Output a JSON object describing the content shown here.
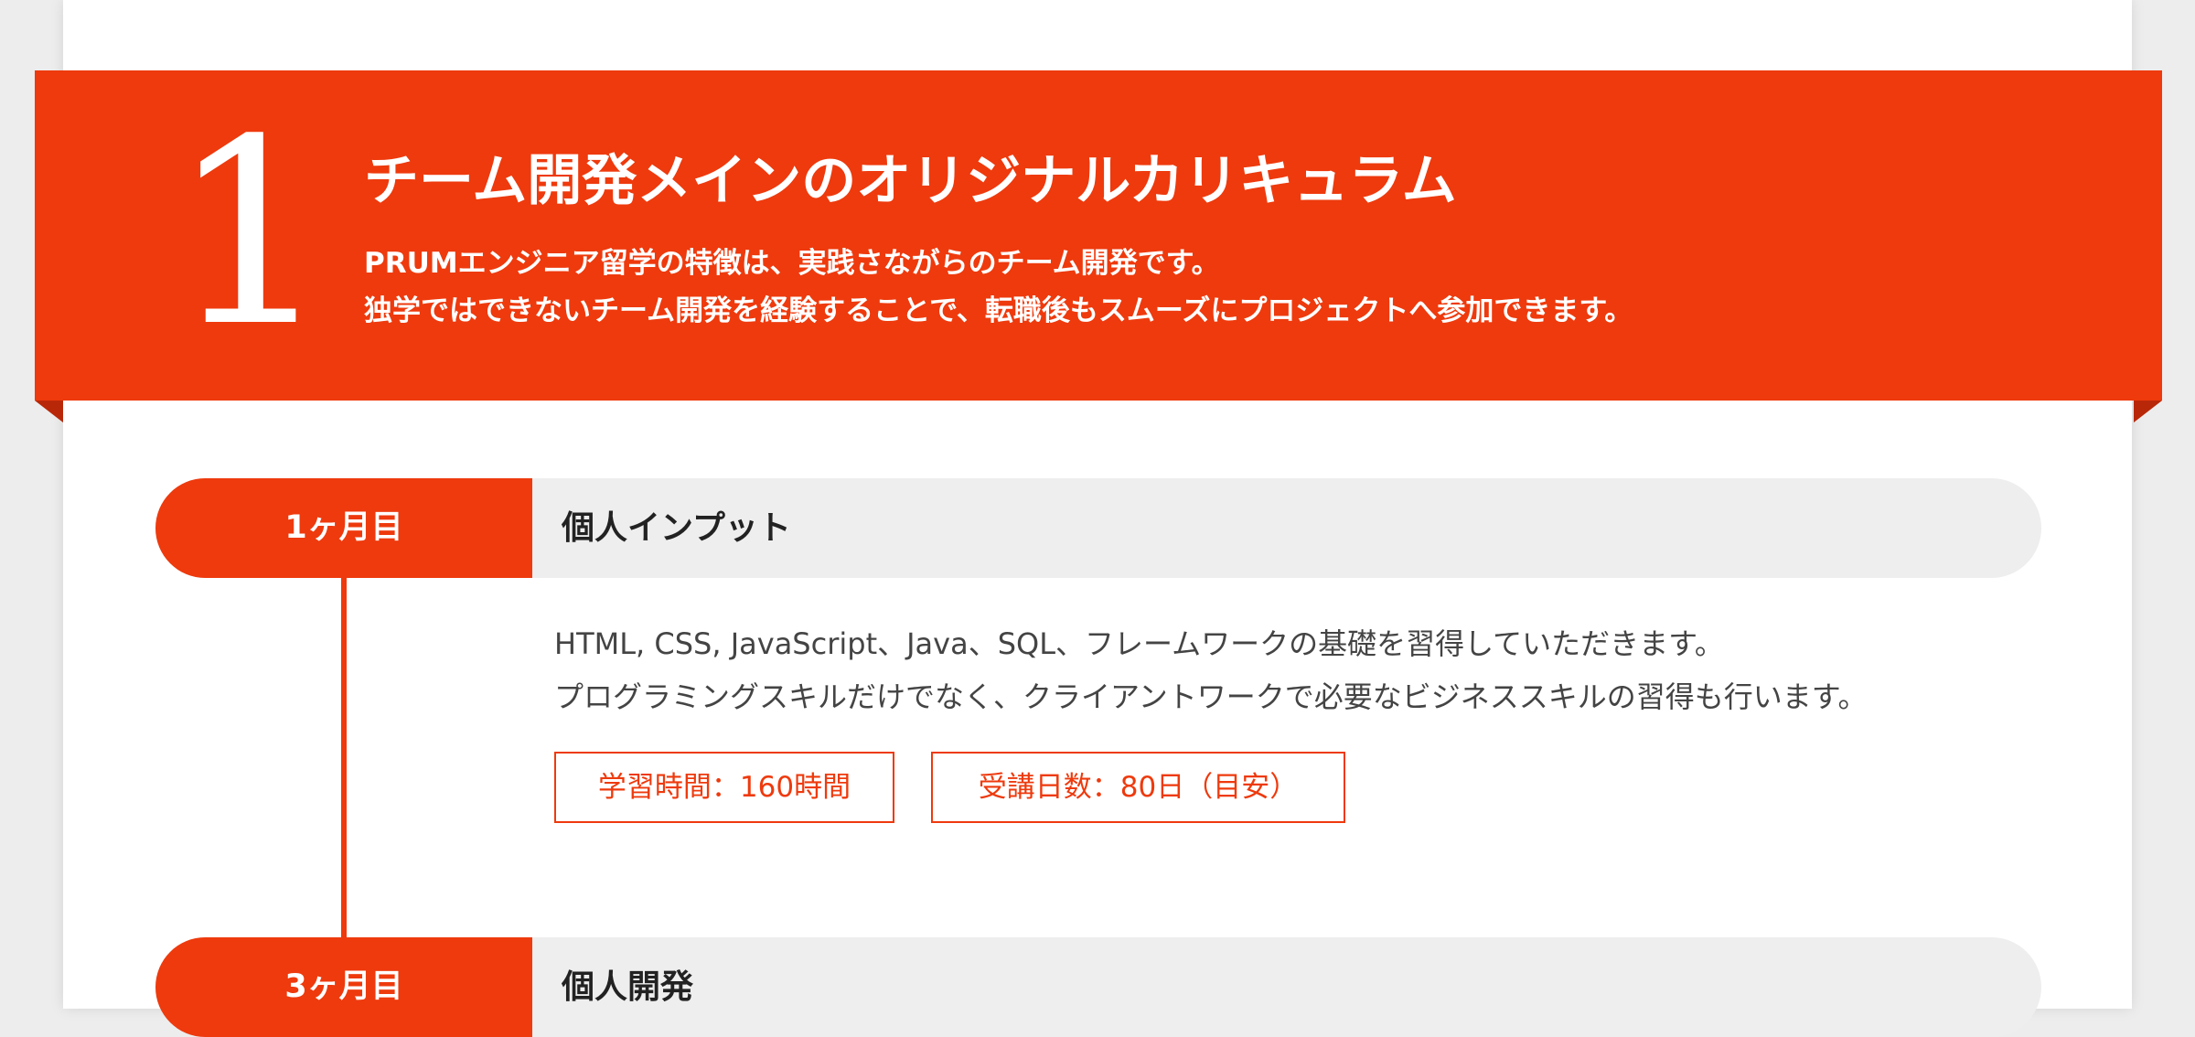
{
  "colors": {
    "accent": "#ee3a0d",
    "background": "#ededed",
    "card": "#ffffff",
    "step_bar": "#eeeeee"
  },
  "feature": {
    "number": "1",
    "title": "チーム開発メインのオリジナルカリキュラム",
    "description_lines": [
      "PRUMエンジニア留学の特徴は、実践さながらのチーム開発です。",
      "独学ではできないチーム開発を経験することで、転職後もスムーズにプロジェクトへ参加できます。"
    ]
  },
  "steps": [
    {
      "label": "1ヶ月目",
      "title": "個人インプット",
      "description_lines": [
        "HTML, CSS, JavaScript、Java、SQL、フレームワークの基礎を習得していただきます。",
        "プログラミングスキルだけでなく、クライアントワークで必要なビジネススキルの習得も行います。"
      ],
      "tags": [
        "学習時間：160時間",
        "受講日数：80日（目安）"
      ]
    },
    {
      "label": "3ヶ月目",
      "title": "個人開発"
    }
  ]
}
